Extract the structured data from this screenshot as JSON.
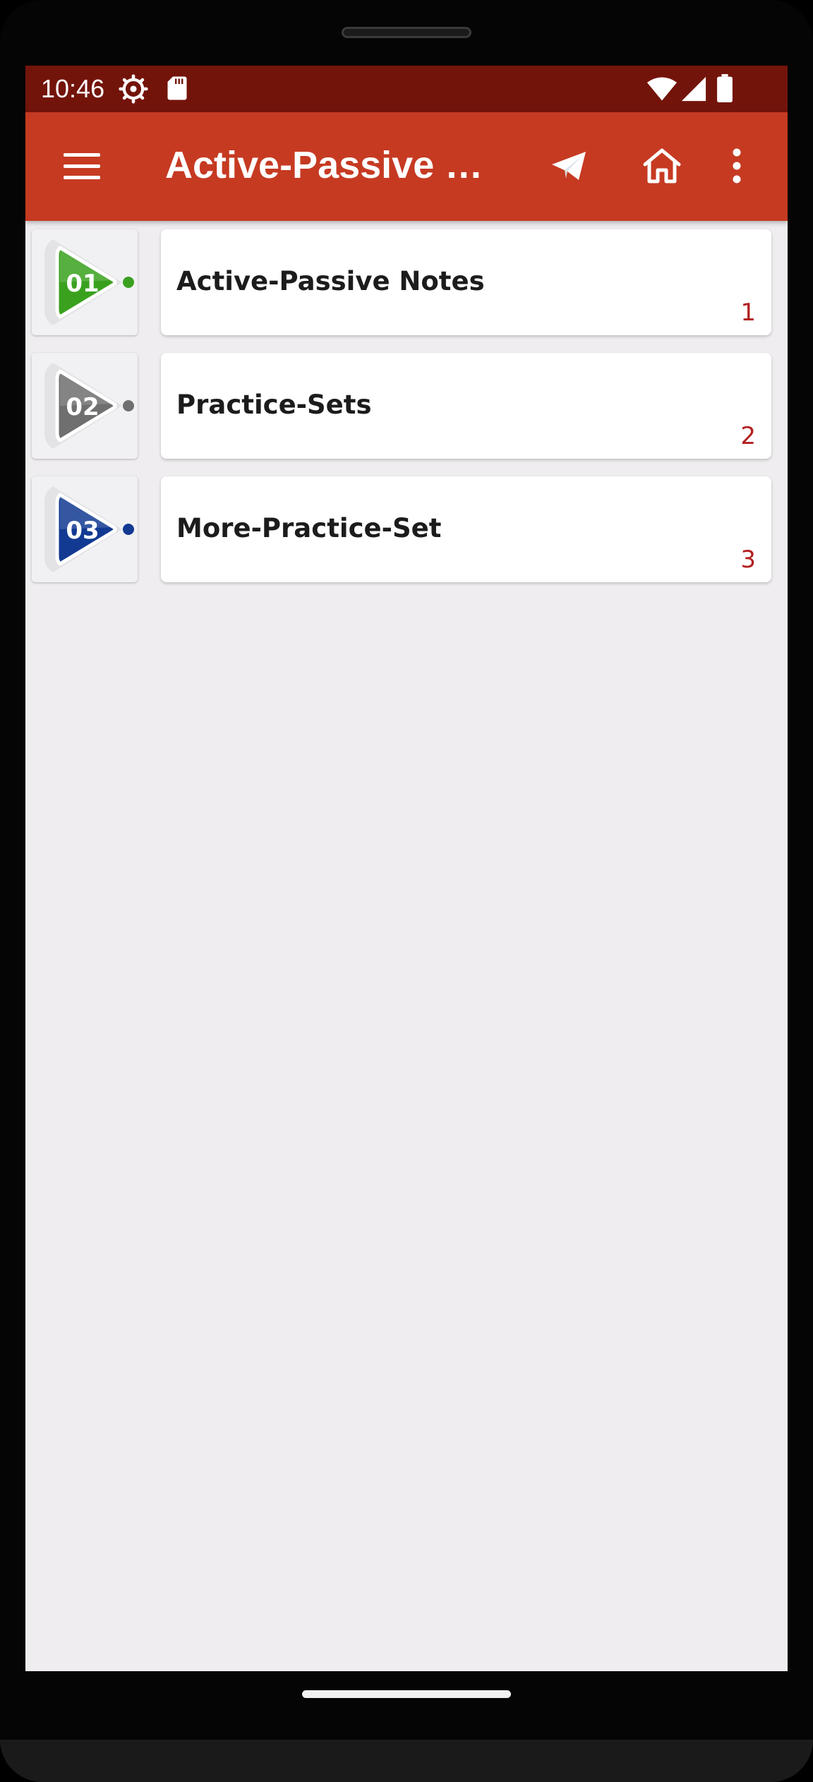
{
  "status_bar": {
    "time": "10:46",
    "icons": [
      "gear-icon",
      "sd-card-icon",
      "wifi-icon",
      "signal-icon",
      "battery-icon"
    ]
  },
  "toolbar": {
    "title": "Active-Passive V...",
    "actions": [
      "menu-icon",
      "send-icon",
      "home-icon",
      "more-vert-icon"
    ]
  },
  "items": [
    {
      "badge": "01",
      "title": "Active-Passive Notes",
      "number": "1",
      "color": "#3aa11f"
    },
    {
      "badge": "02",
      "title": "Practice-Sets",
      "number": "2",
      "color": "#6f6f6f"
    },
    {
      "badge": "03",
      "title": "More-Practice-Set",
      "number": "3",
      "color": "#123a92"
    }
  ],
  "colors": {
    "status_bar": "#73140b",
    "toolbar": "#c63a22",
    "background": "#efedef",
    "number_accent": "#b22020"
  }
}
